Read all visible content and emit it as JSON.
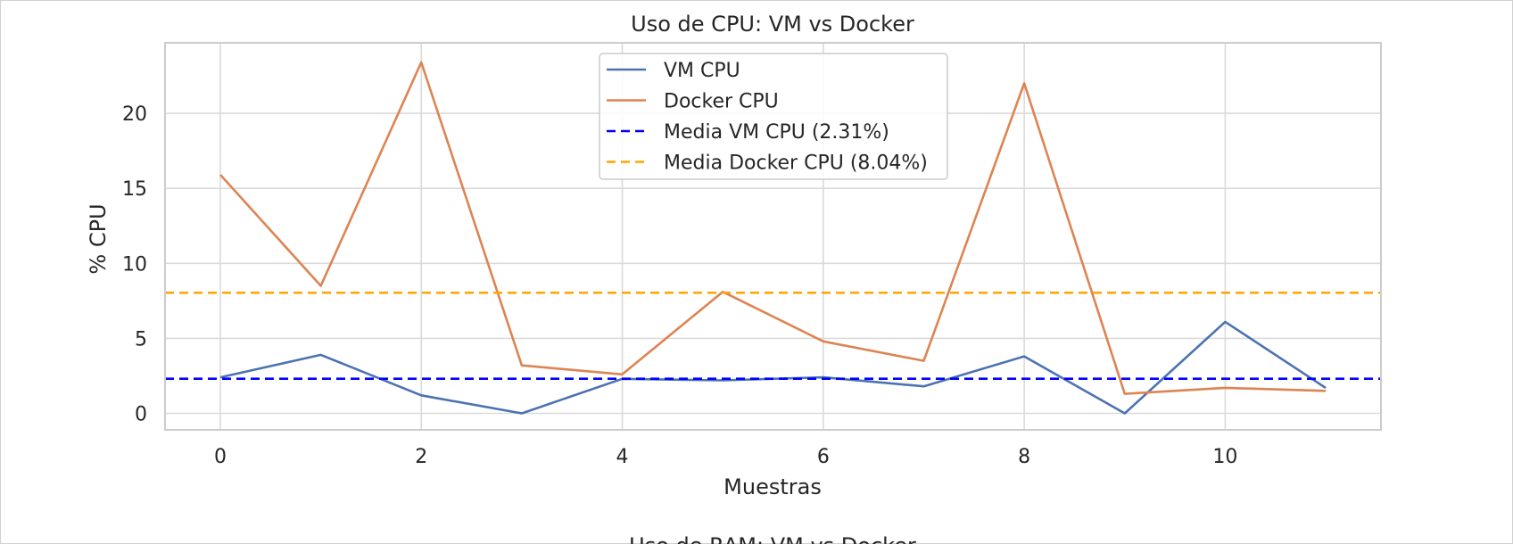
{
  "chart_data": {
    "type": "line",
    "title": "Uso de CPU: VM vs Docker",
    "xlabel": "Muestras",
    "ylabel": "% CPU",
    "xlim": [
      -0.55,
      11.55
    ],
    "ylim": [
      -1.1,
      24.7
    ],
    "xticks": [
      0,
      2,
      4,
      6,
      8,
      10
    ],
    "yticks": [
      0,
      5,
      10,
      15,
      20
    ],
    "grid": true,
    "legend_position": "top-center",
    "x": [
      0,
      1,
      2,
      3,
      4,
      5,
      6,
      7,
      8,
      9,
      10,
      11
    ],
    "series": [
      {
        "name": "VM CPU",
        "style": "solid",
        "color": "#4c72b0",
        "values": [
          2.4,
          3.9,
          1.2,
          0.0,
          2.3,
          2.2,
          2.4,
          1.8,
          3.8,
          0.0,
          6.1,
          1.7
        ]
      },
      {
        "name": "Docker CPU",
        "style": "solid",
        "color": "#dd8452",
        "values": [
          15.9,
          8.5,
          23.4,
          3.2,
          2.6,
          8.1,
          4.8,
          3.5,
          22.0,
          1.3,
          1.7,
          1.5
        ]
      },
      {
        "name": "Media VM CPU (2.31%)",
        "style": "dashed",
        "color": "#0000ff",
        "value": 2.31
      },
      {
        "name": "Media Docker CPU (8.04%)",
        "style": "dashed",
        "color": "#ffa500",
        "value": 8.04
      }
    ],
    "next_chart_title_partial": "Uso de RAM: VM vs Docker"
  }
}
